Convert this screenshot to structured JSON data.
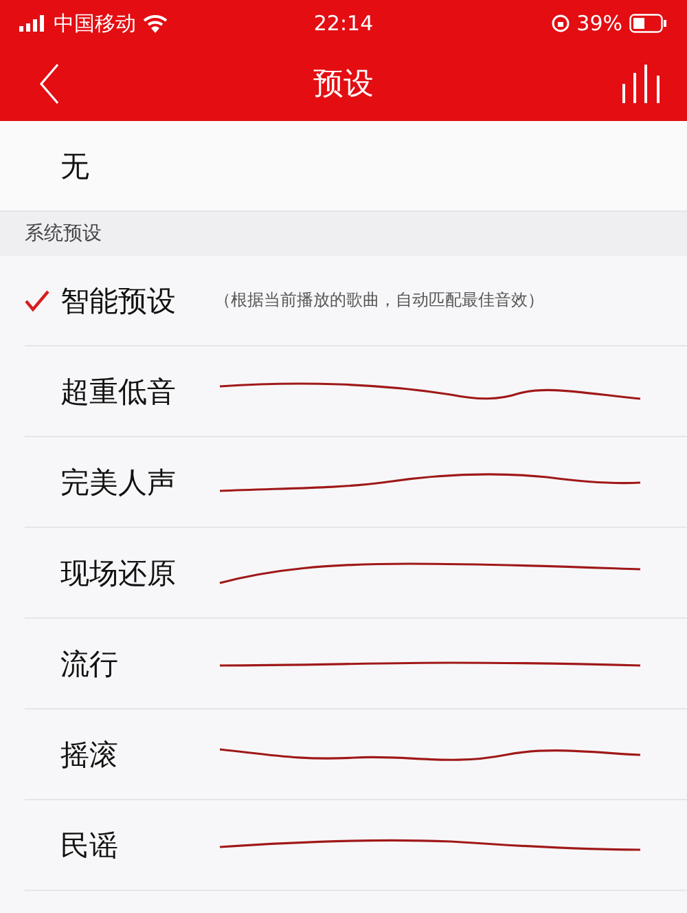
{
  "status_bar": {
    "carrier": "中国移动",
    "time": "22:14",
    "battery": "39%"
  },
  "nav": {
    "title": "预设"
  },
  "none_option": {
    "label": "无",
    "selected": false
  },
  "section": {
    "title": "系统预设"
  },
  "presets": [
    {
      "name": "智能预设",
      "note": "（根据当前播放的歌曲，自动匹配最佳音效）",
      "selected": true
    },
    {
      "name": "超重低音",
      "selected": false
    },
    {
      "name": "完美人声",
      "selected": false
    },
    {
      "name": "现场还原",
      "selected": false
    },
    {
      "name": "流行",
      "selected": false
    },
    {
      "name": "摇滚",
      "selected": false
    },
    {
      "name": "民谣",
      "selected": false
    }
  ]
}
